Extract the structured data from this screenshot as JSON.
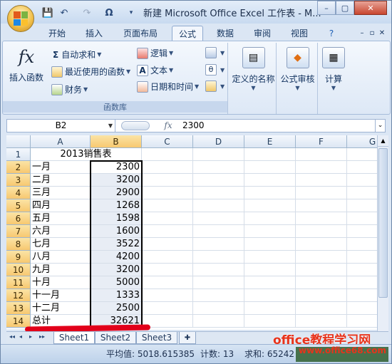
{
  "window": {
    "title": "新建 Microsoft Office Excel 工作表 - M...",
    "min": "–",
    "restore": "▢",
    "close": "✕"
  },
  "qat": {
    "save": "💾",
    "undo": "↶",
    "redo": "↷",
    "omega": "Ω",
    "customize": "▾"
  },
  "tabs": [
    {
      "label": "开始"
    },
    {
      "label": "插入"
    },
    {
      "label": "页面布局"
    },
    {
      "label": "公式",
      "active": true
    },
    {
      "label": "数据"
    },
    {
      "label": "审阅"
    },
    {
      "label": "视图"
    }
  ],
  "ribbon": {
    "insert_function": "插入函数",
    "fx": "fx",
    "autosum": "自动求和",
    "recent": "最近使用的函数",
    "finance": "财务",
    "logic": "逻辑",
    "text": "文本",
    "datetime": "日期和时间",
    "group_label": "函数库",
    "defined_names": "定义的名称",
    "formula_audit": "公式审核",
    "calc": "计算",
    "sigma": "Σ",
    "letter_a": "A",
    "theta": "θ"
  },
  "formula": {
    "namebox": "B2",
    "fx": "fx",
    "value": "2300"
  },
  "columns": [
    "A",
    "B",
    "C",
    "D",
    "E",
    "F",
    "G"
  ],
  "rows": [
    {
      "n": "1",
      "a": "",
      "b": "",
      "title": "2013销售表"
    },
    {
      "n": "2",
      "a": "一月",
      "b": "2300"
    },
    {
      "n": "3",
      "a": "二月",
      "b": "3200"
    },
    {
      "n": "4",
      "a": "三月",
      "b": "2900"
    },
    {
      "n": "5",
      "a": "四月",
      "b": "1268"
    },
    {
      "n": "6",
      "a": "五月",
      "b": "1598"
    },
    {
      "n": "7",
      "a": "六月",
      "b": "1600"
    },
    {
      "n": "8",
      "a": "七月",
      "b": "3522"
    },
    {
      "n": "9",
      "a": "八月",
      "b": "4200"
    },
    {
      "n": "10",
      "a": "九月",
      "b": "3200"
    },
    {
      "n": "11",
      "a": "十月",
      "b": "5000"
    },
    {
      "n": "12",
      "a": "十一月",
      "b": "1333"
    },
    {
      "n": "13",
      "a": "十二月",
      "b": "2500"
    },
    {
      "n": "14",
      "a": "总计",
      "b": "32621"
    }
  ],
  "sheets": [
    {
      "label": "Sheet1",
      "active": true
    },
    {
      "label": "Sheet2"
    },
    {
      "label": "Sheet3"
    }
  ],
  "nav": [
    "◂◂",
    "◂",
    "▸",
    "▸▸"
  ],
  "status": {
    "average": "平均值: 5018.615385",
    "count": "计数: 13",
    "sum": "求和: 65242"
  },
  "watermark": {
    "line1": "office教程学习网",
    "line2": "www.office68.com"
  },
  "colors": {
    "accent": "#e2001a",
    "selection": "#fbe4a6"
  }
}
